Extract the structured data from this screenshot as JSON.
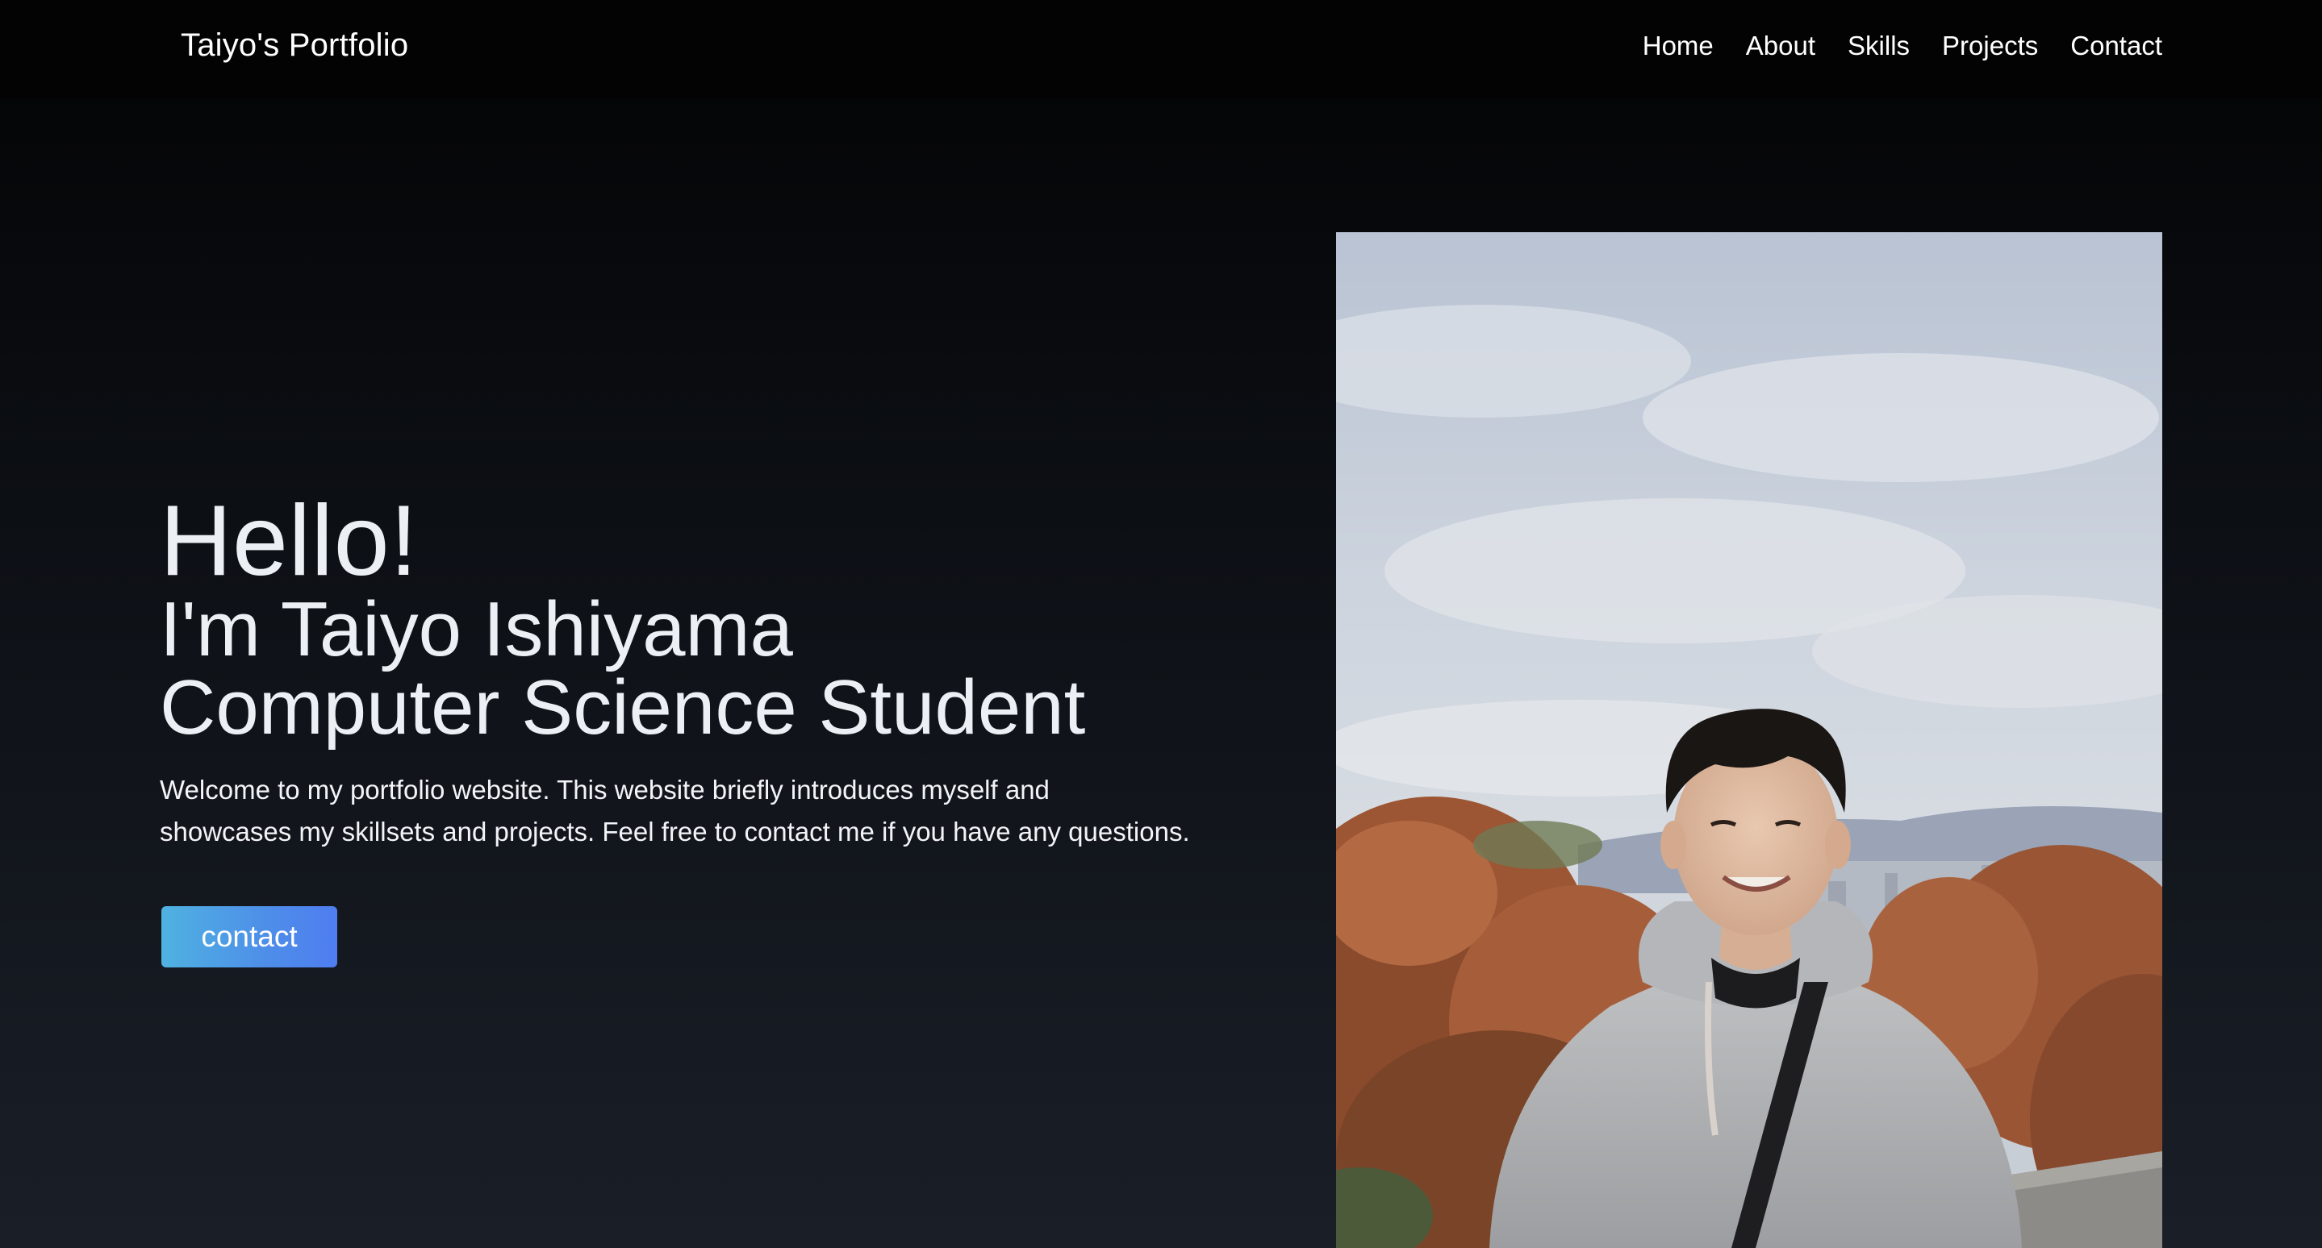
{
  "nav": {
    "brand": "Taiyo's Portfolio",
    "links": [
      "Home",
      "About",
      "Skills",
      "Projects",
      "Contact"
    ]
  },
  "hero": {
    "greeting": "Hello!",
    "name_line": "I'm Taiyo Ishiyama",
    "role_line": "Computer Science Student",
    "intro_line1": "Welcome to my portfolio website. This website briefly introduces myself and",
    "intro_line2": "showcases my skillsets and projects. Feel free to contact me if you have any questions.",
    "cta_label": "contact"
  },
  "photo": {
    "subject": "portrait-photo"
  },
  "colors": {
    "accent_start": "#4fb2e1",
    "accent_end": "#4f7df0",
    "nav_bg": "#030303",
    "page_bg_bottom": "#1a1e27"
  }
}
